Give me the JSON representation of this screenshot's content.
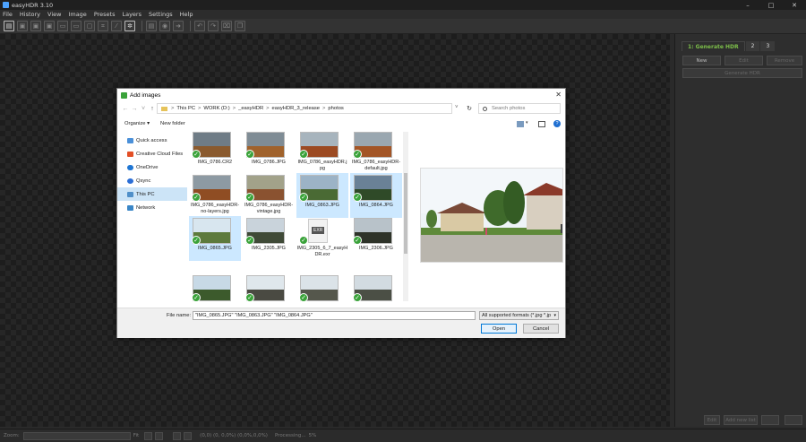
{
  "app": {
    "title": "easyHDR 3.10",
    "window_controls": [
      "–",
      "□",
      "✕"
    ]
  },
  "menu": [
    "File",
    "History",
    "View",
    "Image",
    "Presets",
    "Layers",
    "Settings",
    "Help"
  ],
  "right_panel": {
    "tabs": [
      "1: Generate HDR",
      "2",
      "3"
    ],
    "new_button": "New",
    "edit_button": "Edit",
    "remove_button": "Remove",
    "generate_button": "Generate HDR",
    "bottom_edit": "Edit",
    "bottom_dropdown": "Add new list"
  },
  "status": {
    "zoom": "Zoom:",
    "fit": "Fit",
    "info": "(0,0) (0, 0,0%) (0,0%,0,0%)",
    "processing": "Processing...",
    "processing_value": "5%"
  },
  "dialog": {
    "title": "Add images",
    "close": "✕",
    "address": {
      "segments": [
        "This PC",
        "WORK (D:)",
        "_easyHDR",
        "easyHDR_3_release",
        "photos"
      ],
      "separator": ">"
    },
    "search_placeholder": "Search photos",
    "commands": {
      "organize": "Organize ▾",
      "new_folder": "New folder"
    },
    "nav": [
      "Quick access",
      "Creative Cloud Files",
      "OneDrive",
      "Qsync",
      "This PC",
      "Network"
    ],
    "files": [
      {
        "name": "IMG_0786.CR2",
        "selected": false
      },
      {
        "name": "IMG_0786.JPG",
        "selected": false
      },
      {
        "name": "IMG_0786_easyHDR.jpg",
        "selected": false
      },
      {
        "name": "IMG_0786_easyHDR-default.jpg",
        "selected": false
      },
      {
        "name": "IMG_0786_easyHDR-no-layers.jpg",
        "selected": false
      },
      {
        "name": "IMG_0786_easyHDR-vintage.jpg",
        "selected": false
      },
      {
        "name": "IMG_0863.JPG",
        "selected": true
      },
      {
        "name": "IMG_0864.JPG",
        "selected": true
      },
      {
        "name": "IMG_0865.JPG",
        "selected": true
      },
      {
        "name": "IMG_2305.JPG",
        "selected": false
      },
      {
        "name": "IMG_2305_6_7_easyHDR.exr",
        "selected": false
      },
      {
        "name": "IMG_2306.JPG",
        "selected": false
      }
    ],
    "exr_label": "EXR",
    "filename_label": "File name:",
    "filename_value": "\"IMG_0865.JPG\" \"IMG_0863.JPG\" \"IMG_0864.JPG\"",
    "filetype": "All supported formats (*.jpg *.jp",
    "open_label": "Open",
    "cancel_label": "Cancel"
  }
}
